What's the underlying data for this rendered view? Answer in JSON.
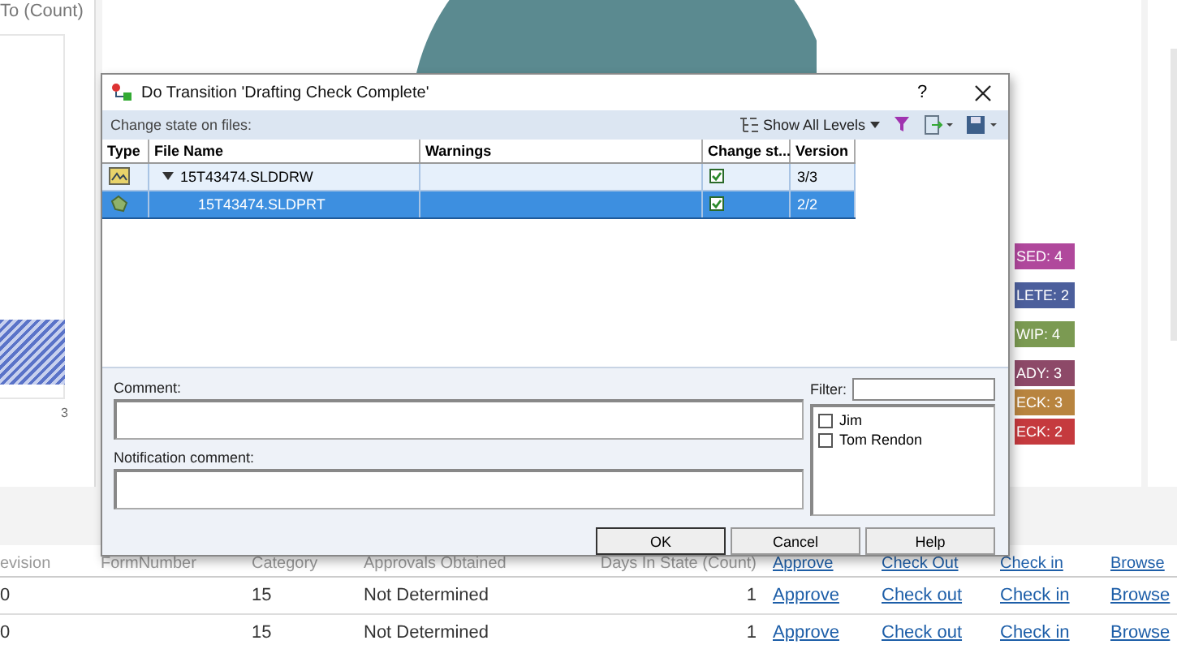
{
  "background": {
    "chart_title": "To (Count)",
    "chart_tick": "3",
    "status_badges": [
      {
        "label": "SED: 4",
        "color": "#b0489c"
      },
      {
        "label": "LETE: 2",
        "color": "#4c5f9c"
      },
      {
        "label": "WIP: 4",
        "color": "#7b9a52"
      },
      {
        "label": "ADY: 3",
        "color": "#8d4968"
      },
      {
        "label": "ECK: 3",
        "color": "#b8843f"
      },
      {
        "label": "ECK: 2",
        "color": "#c53a3e"
      }
    ],
    "table": {
      "columns": [
        {
          "label": "evision",
          "kind": "text"
        },
        {
          "label": "FormNumber",
          "kind": "text"
        },
        {
          "label": "Category",
          "kind": "text"
        },
        {
          "label": "Approvals Obtained",
          "kind": "text"
        },
        {
          "label": "Days In State (Count)",
          "kind": "number"
        },
        {
          "label": "Approve",
          "kind": "link"
        },
        {
          "label": "Check Out",
          "kind": "link"
        },
        {
          "label": "Check in",
          "kind": "link"
        },
        {
          "label": "Browse",
          "kind": "link"
        }
      ],
      "rows": [
        {
          "cells": [
            "0",
            "",
            "15",
            "Not Determined",
            "1",
            "Approve",
            "Check out",
            "Check in",
            "Browse"
          ]
        },
        {
          "cells": [
            "0",
            "",
            "15",
            "Not Determined",
            "1",
            "Approve",
            "Check out",
            "Check in",
            "Browse"
          ]
        }
      ]
    }
  },
  "dialog": {
    "title": "Do Transition 'Drafting Check Complete'",
    "help_button": "?",
    "subtitle": "Change state on files:",
    "show_levels": "Show All Levels",
    "columns": [
      "Type",
      "File Name",
      "Warnings",
      "Change st...",
      "Version"
    ],
    "files": [
      {
        "name": "15T43474.SLDDRW",
        "kind": "drawing",
        "expanded": true,
        "change_state": true,
        "version": "3/3",
        "selected": false,
        "children": [
          {
            "name": "15T43474.SLDPRT",
            "kind": "part",
            "change_state": true,
            "version": "2/2",
            "selected": true
          }
        ]
      }
    ],
    "comment_label": "Comment:",
    "notification_label": "Notification comment:",
    "filter_label": "Filter:",
    "users": [
      {
        "name": "Jim",
        "checked": false
      },
      {
        "name": "Tom Rendon",
        "checked": false
      }
    ],
    "buttons": [
      "OK",
      "Cancel",
      "Help"
    ]
  }
}
